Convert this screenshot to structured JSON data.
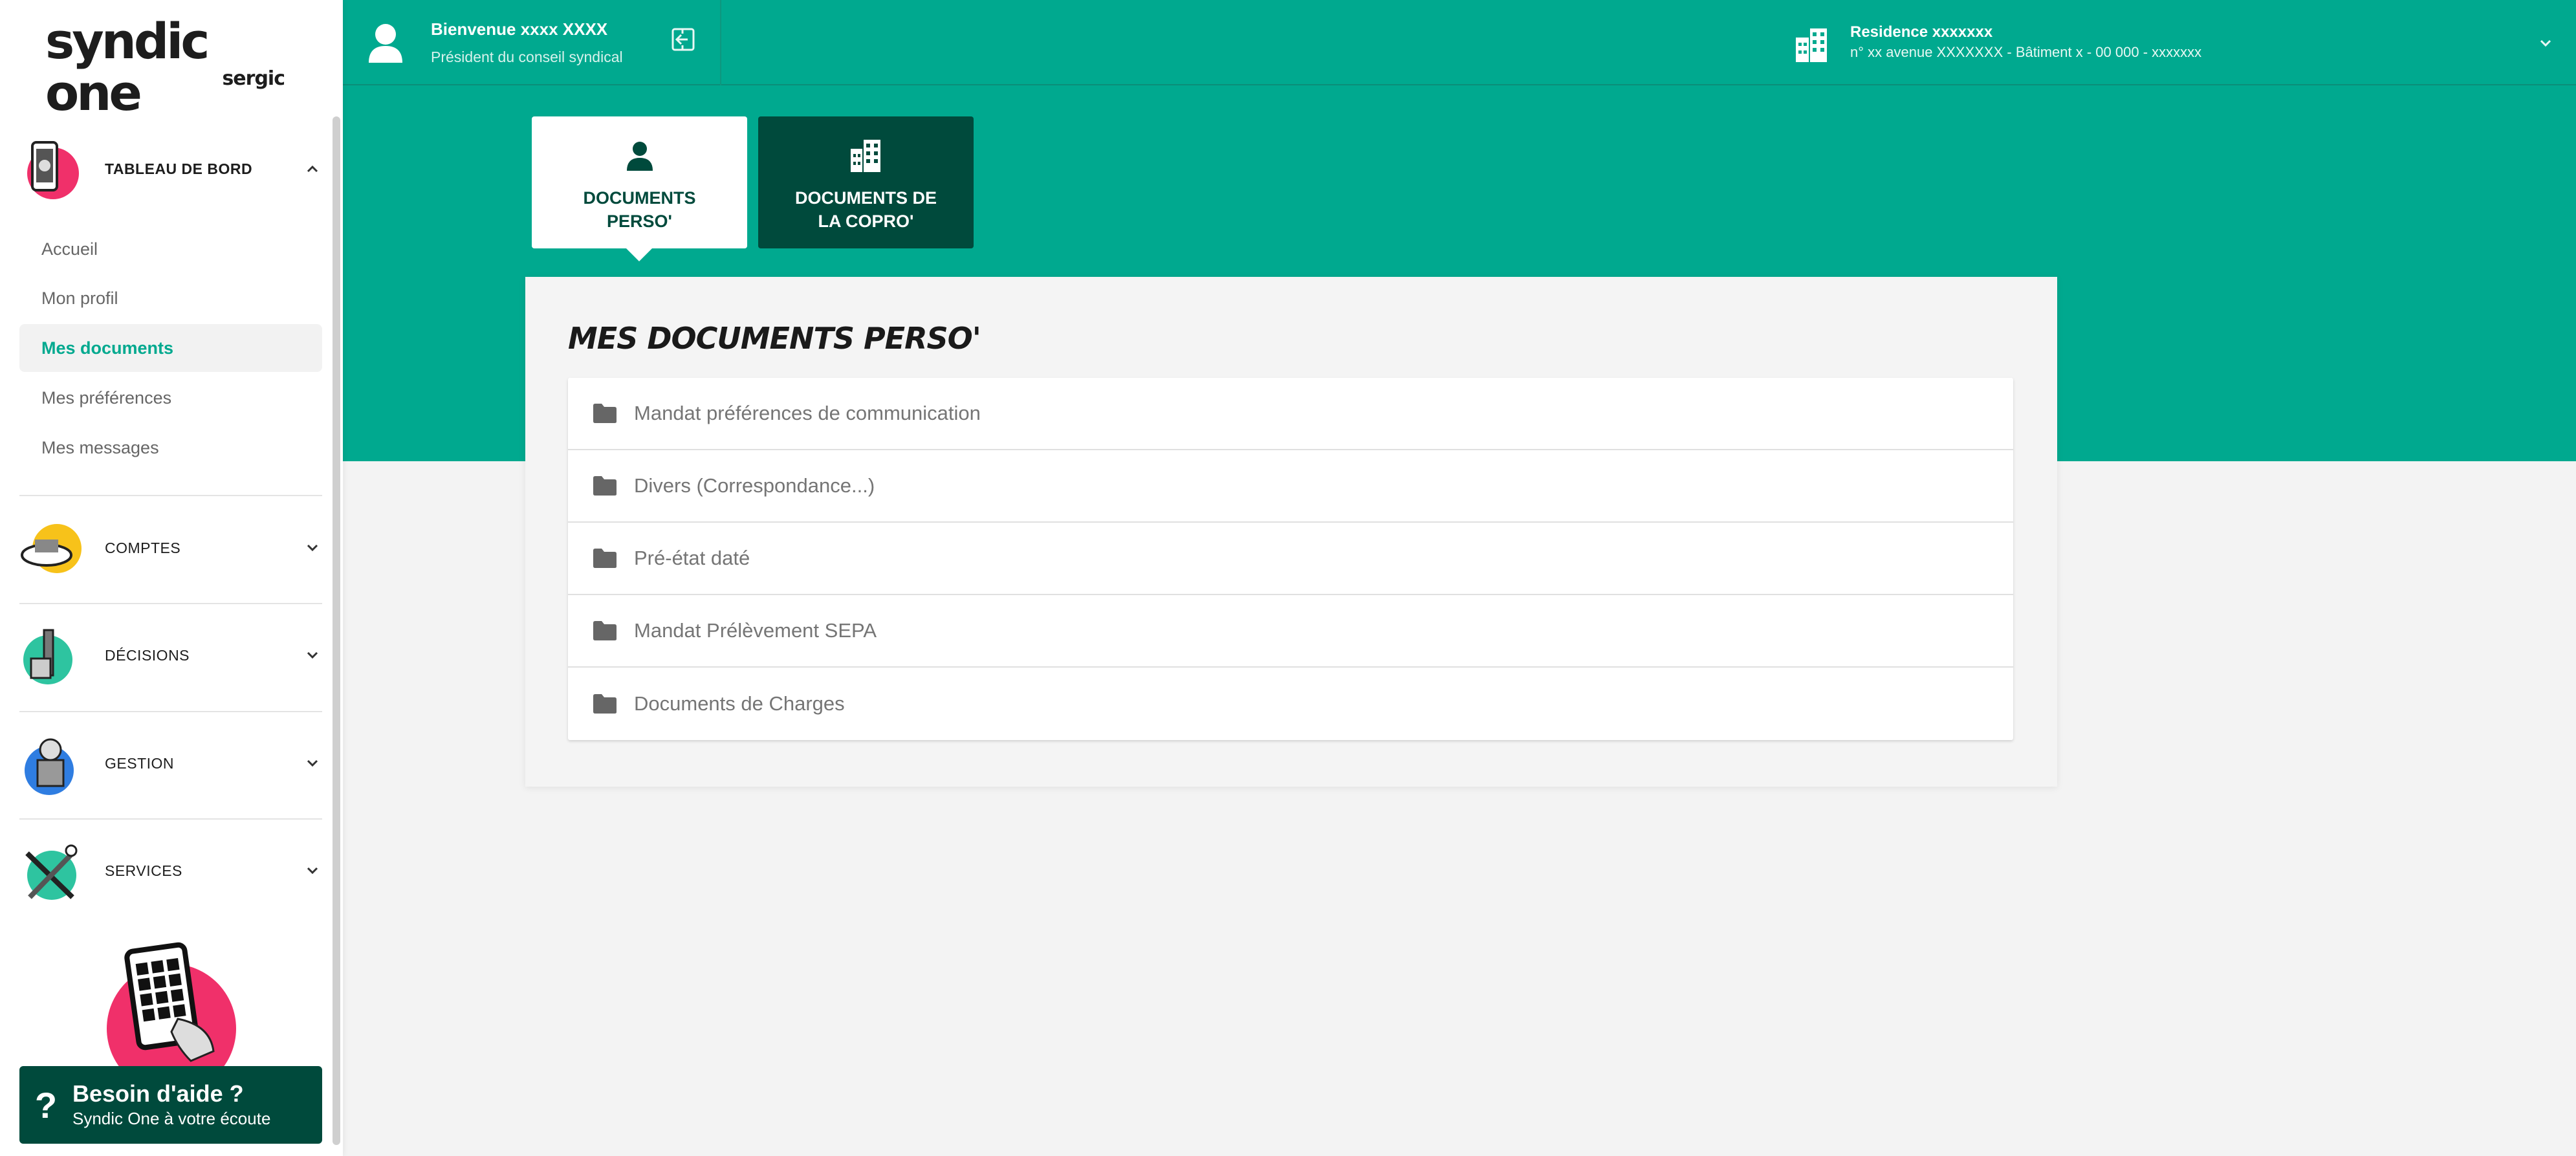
{
  "brand": {
    "name": "syndic one",
    "sub": "sergic"
  },
  "header": {
    "welcome": "Bienvenue xxxx XXXX",
    "role": "Président du conseil syndical",
    "residence_name": "Residence xxxxxxx",
    "residence_address": "n° xx avenue XXXXXXX - Bâtiment x - 00 000 - xxxxxxx"
  },
  "sidebar": {
    "groups": [
      {
        "label": "TABLEAU DE BORD",
        "expanded": true,
        "color": "#f0306a"
      },
      {
        "label": "COMPTES",
        "expanded": false,
        "color": "#f7c21a"
      },
      {
        "label": "DÉCISIONS",
        "expanded": false,
        "color": "#2ec4a0"
      },
      {
        "label": "GESTION",
        "expanded": false,
        "color": "#2f7de1"
      },
      {
        "label": "SERVICES",
        "expanded": false,
        "color": "#2ec4a0"
      }
    ],
    "sub_items": [
      {
        "label": "Accueil",
        "active": false
      },
      {
        "label": "Mon profil",
        "active": false
      },
      {
        "label": "Mes documents",
        "active": true
      },
      {
        "label": "Mes préférences",
        "active": false
      },
      {
        "label": "Mes messages",
        "active": false
      }
    ],
    "help": {
      "title": "Besoin d'aide ?",
      "subtitle": "Syndic One à votre écoute",
      "glyph": "?"
    }
  },
  "tabs": [
    {
      "label": "DOCUMENTS\nPERSO'",
      "active": true,
      "icon": "person-icon"
    },
    {
      "label": "DOCUMENTS DE\nLA COPRO'",
      "active": false,
      "icon": "building-icon"
    }
  ],
  "main": {
    "title": "MES DOCUMENTS PERSO'",
    "folders": [
      "Mandat préférences de communication",
      "Divers (Correspondance...)",
      "Pré-état daté",
      "Mandat Prélèvement SEPA",
      "Documents de Charges"
    ]
  },
  "colors": {
    "primary": "#00a98f",
    "dark": "#004a3c",
    "accent": "#f0306a"
  }
}
